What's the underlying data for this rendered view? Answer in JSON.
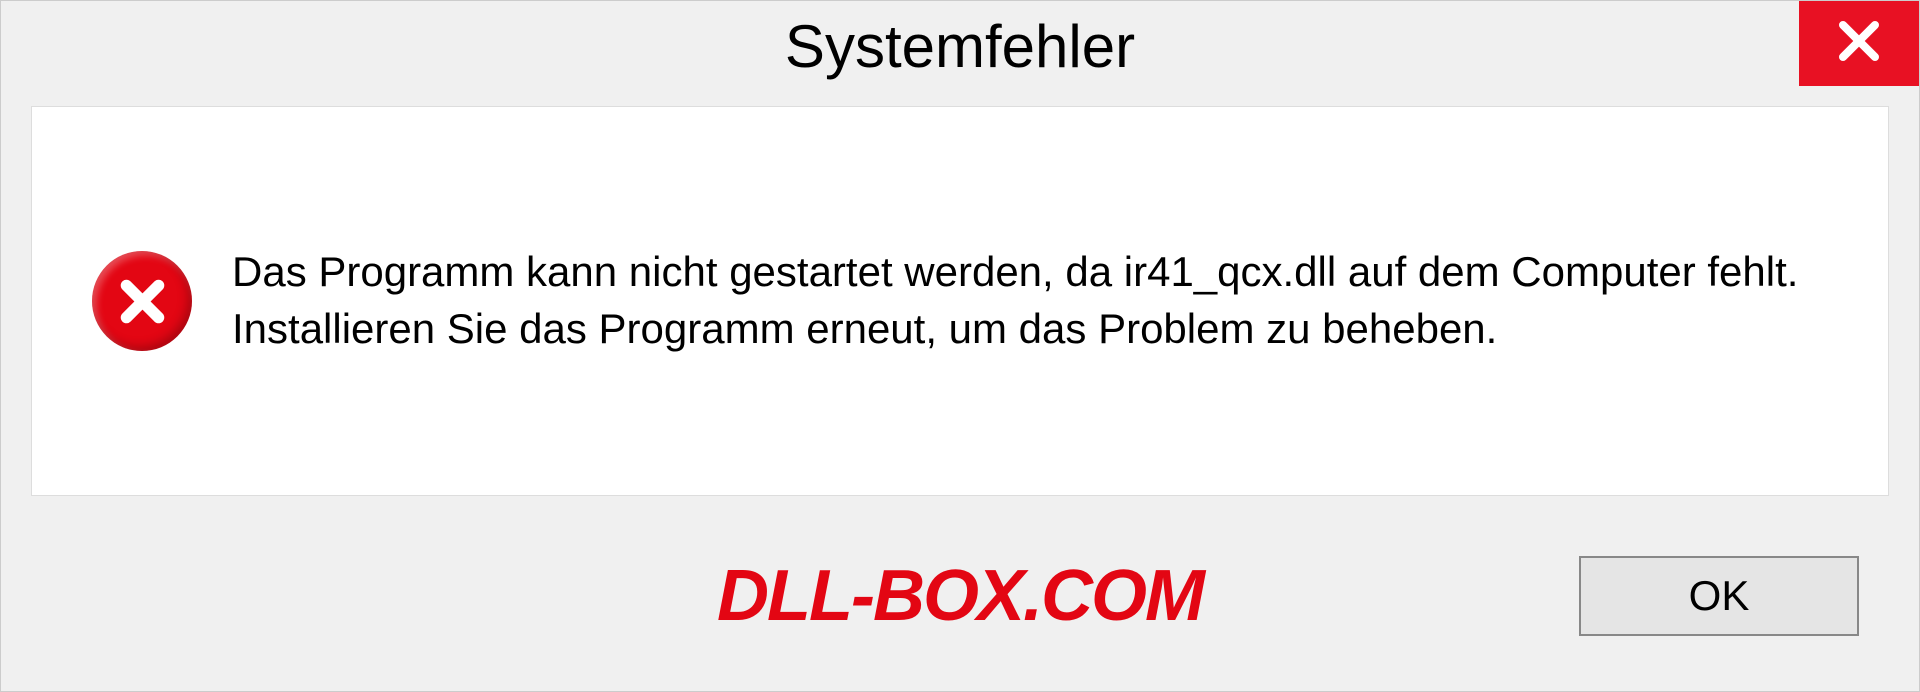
{
  "dialog": {
    "title": "Systemfehler",
    "message": "Das Programm kann nicht gestartet werden, da ir41_qcx.dll auf dem Computer fehlt. Installieren Sie das Programm erneut, um das Problem zu beheben.",
    "ok_label": "OK"
  },
  "watermark": "DLL-BOX.COM",
  "icons": {
    "close": "close-icon",
    "error": "error-icon"
  }
}
